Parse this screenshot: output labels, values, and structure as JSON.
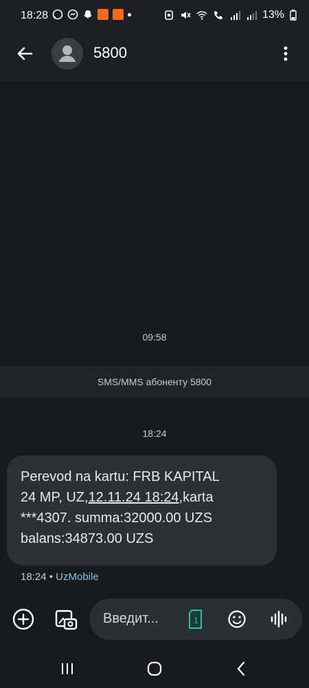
{
  "status": {
    "time": "18:28",
    "battery": "13%",
    "left_icons": [
      "whatsapp-icon",
      "messenger-icon",
      "snapchat-icon",
      "app-badge-icon",
      "app-badge-icon",
      "more-dot-icon"
    ],
    "right_icons": [
      "nfc-icon",
      "mute-icon",
      "wifi-icon",
      "call-icon",
      "signal-icon",
      "signal-icon",
      "battery-icon"
    ]
  },
  "header": {
    "contact": "5800"
  },
  "conversation": {
    "timestamp1": "09:58",
    "notice": "SMS/MMS абоненту 5800",
    "timestamp2": "18:24",
    "message": {
      "line1": "Perevod na kartu: FRB KAPITAL",
      "line2_a": "24 MP, UZ,",
      "line2_link": "12.11.24 18:24",
      "line2_b": ",karta",
      "line3": "***4307. summa:32000.00 UZS",
      "line4": "balans:34873.00 UZS",
      "time": "18:24",
      "separator": "•",
      "carrier": "UzMobile"
    }
  },
  "composer": {
    "placeholder": "Введит...",
    "sim_number": "1"
  },
  "colors": {
    "background": "#171b1e",
    "bubble": "#2d3135",
    "carrier_link": "#7fc4e0",
    "sim_accent": "#27c2a8"
  }
}
